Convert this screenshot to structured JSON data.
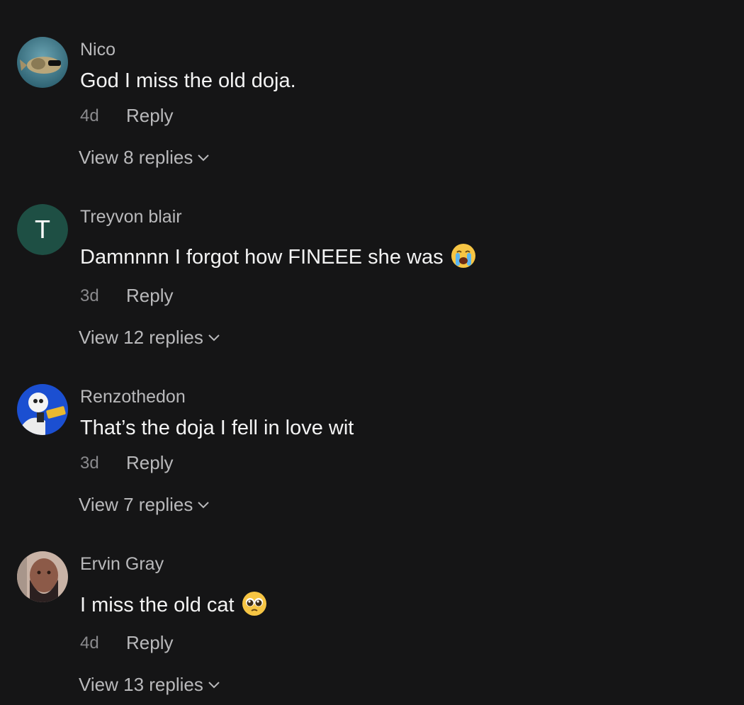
{
  "comments": [
    {
      "username": "Nico",
      "text": "God I miss the old doja.",
      "time": "4d",
      "reply_label": "Reply",
      "view_replies": "View 8 replies",
      "avatar_icon": "photo-avatar",
      "avatar_color": "#4f8a9c"
    },
    {
      "username": "Treyvon blair",
      "text": "Damnnnn I forgot how FINEEE she was",
      "emoji_icon": "loudly-crying-face",
      "time": "3d",
      "reply_label": "Reply",
      "view_replies": "View 12 replies",
      "avatar_letter": "T",
      "avatar_color": "#1e4f44"
    },
    {
      "username": "Renzothedon",
      "text": "That’s the doja I fell in love wit",
      "time": "3d",
      "reply_label": "Reply",
      "view_replies": "View 7 replies",
      "avatar_icon": "photo-avatar",
      "avatar_color": "#1b4fd1"
    },
    {
      "username": "Ervin Gray",
      "text": "I miss the old cat",
      "emoji_icon": "pleading-face",
      "time": "4d",
      "reply_label": "Reply",
      "view_replies": "View 13 replies",
      "avatar_icon": "photo-avatar",
      "avatar_color": "#8c5a48"
    }
  ]
}
